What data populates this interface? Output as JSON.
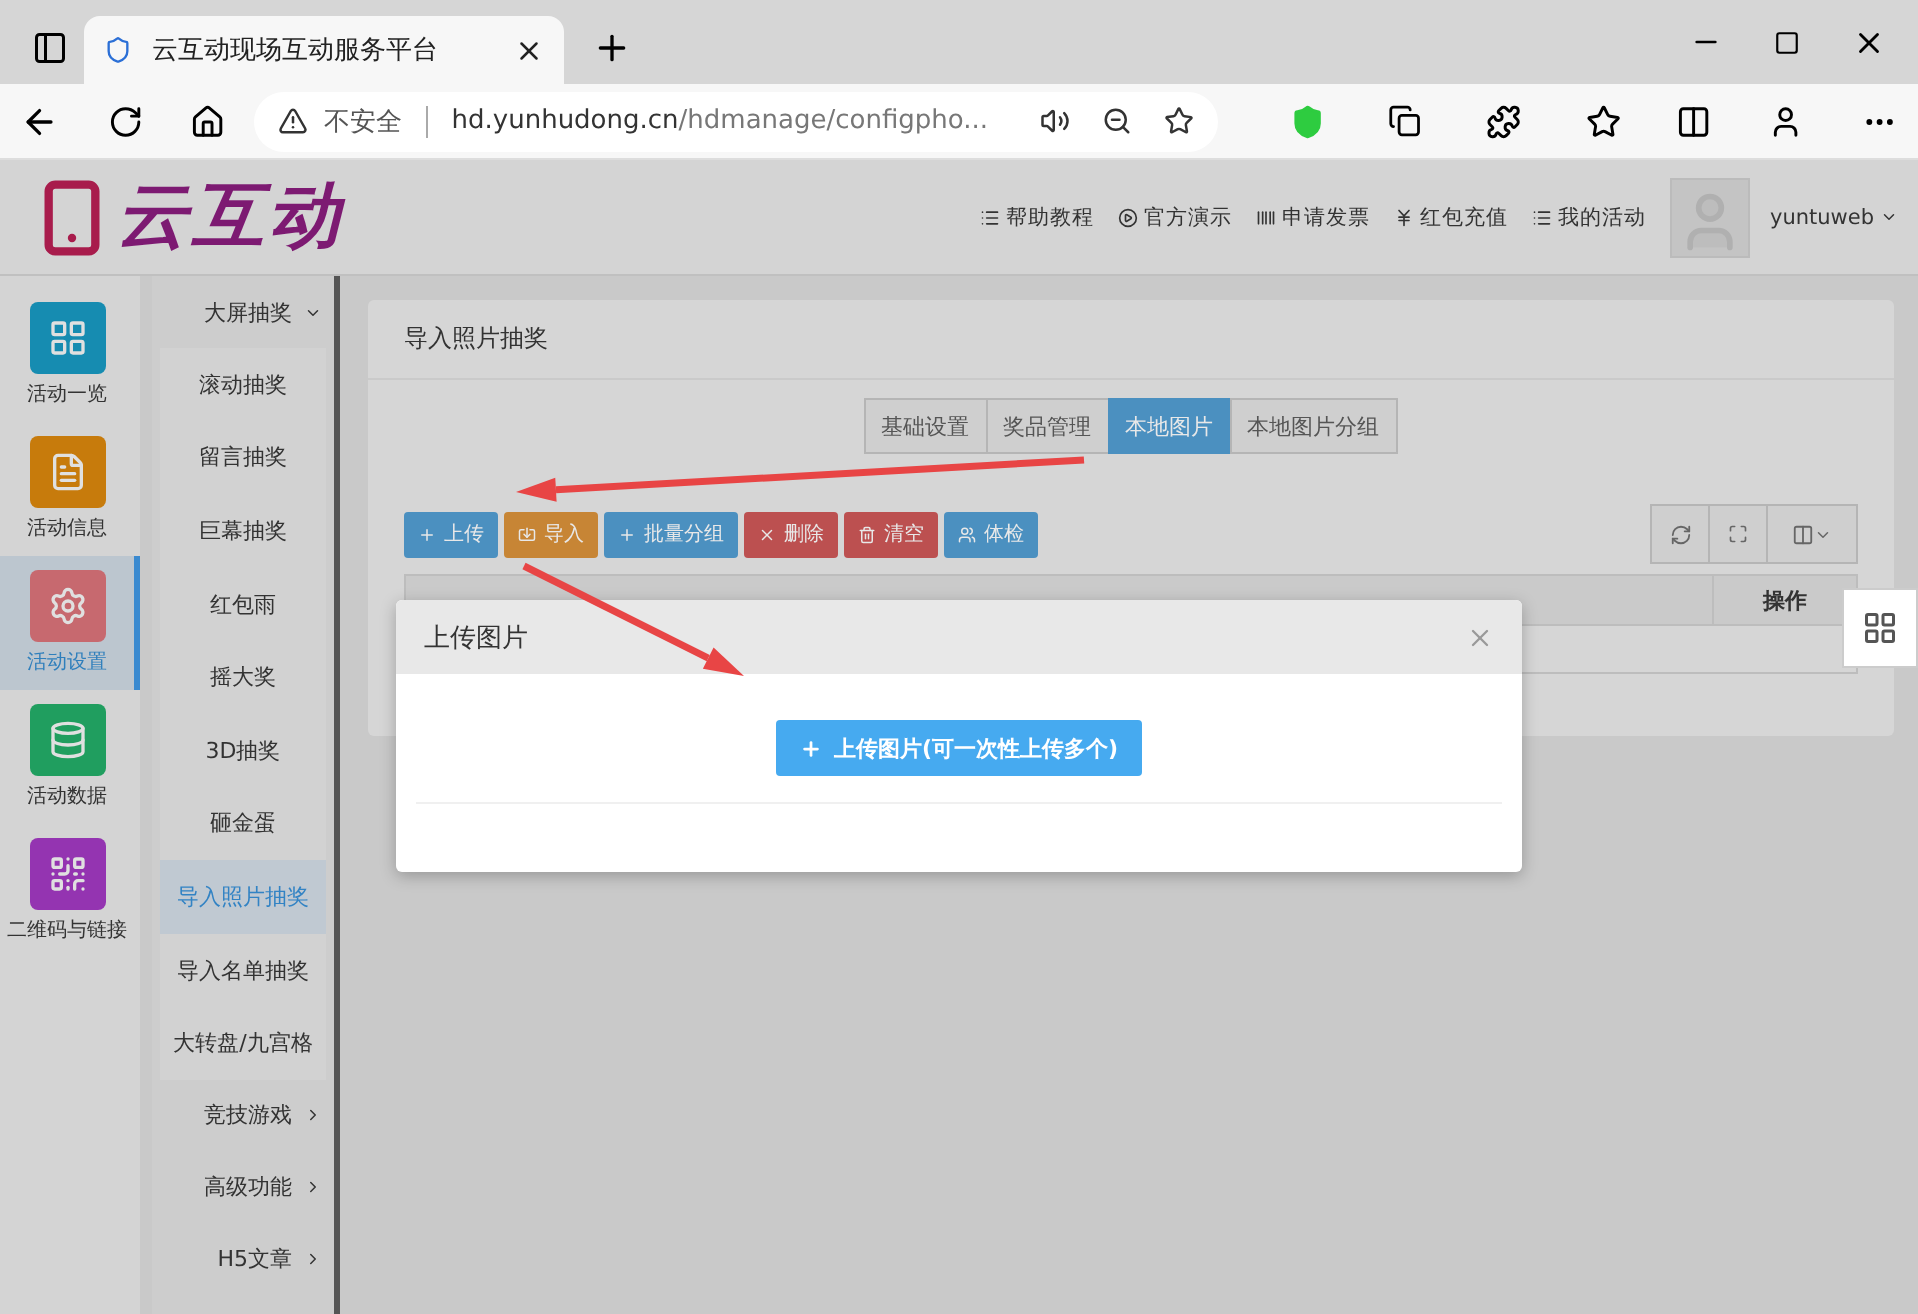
{
  "browser": {
    "tab_title": "云互动现场互动服务平台",
    "security": "不安全",
    "url_host": "hd.yunhudong.cn",
    "url_path": "/hdmanage/configpho..."
  },
  "header": {
    "logo": "云互动",
    "nav": [
      "帮助教程",
      "官方演示",
      "申请发票",
      "红包充值",
      "我的活动"
    ],
    "user": "yuntuweb"
  },
  "sidebar": {
    "items": [
      {
        "label": "活动一览",
        "selected": false,
        "color": "#168cb1"
      },
      {
        "label": "活动信息",
        "selected": false,
        "color": "#c77b0c"
      },
      {
        "label": "活动设置",
        "selected": true,
        "color": "#c7696f"
      },
      {
        "label": "活动数据",
        "selected": false,
        "color": "#209e5f"
      },
      {
        "label": "二维码与链接",
        "selected": false,
        "color": "#9434b1"
      }
    ]
  },
  "submenu": [
    {
      "label": "大屏抽奖",
      "expanded": true,
      "children": [
        {
          "label": "滚动抽奖",
          "selected": false
        },
        {
          "label": "留言抽奖",
          "selected": false
        },
        {
          "label": "巨幕抽奖",
          "selected": false
        },
        {
          "label": "红包雨",
          "selected": false
        },
        {
          "label": "摇大奖",
          "selected": false
        },
        {
          "label": "3D抽奖",
          "selected": false
        },
        {
          "label": "砸金蛋",
          "selected": false
        },
        {
          "label": "导入照片抽奖",
          "selected": true
        },
        {
          "label": "导入名单抽奖",
          "selected": false
        },
        {
          "label": "大转盘/九宫格",
          "selected": false
        }
      ]
    },
    {
      "label": "竞技游戏",
      "expanded": false
    },
    {
      "label": "高级功能",
      "expanded": false
    },
    {
      "label": "H5文章",
      "expanded": false
    }
  ],
  "panel": {
    "title": "导入照片抽奖",
    "tabs": [
      {
        "label": "基础设置",
        "selected": false
      },
      {
        "label": "奖品管理",
        "selected": false
      },
      {
        "label": "本地图片",
        "selected": true
      },
      {
        "label": "本地图片分组",
        "selected": false
      }
    ],
    "toolbar": [
      {
        "label": "上传",
        "color": "#4b90c0"
      },
      {
        "label": "导入",
        "color": "#c78535"
      },
      {
        "label": "批量分组",
        "color": "#4b90c0"
      },
      {
        "label": "删除",
        "color": "#bc5050"
      },
      {
        "label": "清空",
        "color": "#bc5050"
      },
      {
        "label": "体检",
        "color": "#4b90c0"
      }
    ],
    "table": {
      "columns": [
        "操作"
      ]
    }
  },
  "modal": {
    "title": "上传图片",
    "upload_button": "上传图片(可一次性上传多个)"
  }
}
